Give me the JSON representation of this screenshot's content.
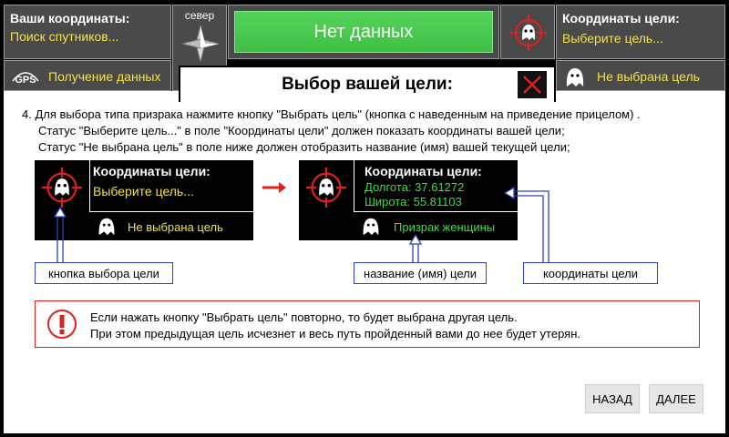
{
  "hud": {
    "coords_title": "Ваши координаты:",
    "coords_status": "Поиск спутников...",
    "gps_label": "GPS",
    "gps_status": "Получение данных",
    "compass_label": "север",
    "status_text": "Нет данных",
    "target_title": "Координаты цели:",
    "target_status": "Выберите цель...",
    "ghost_status": "Не выбрана цель"
  },
  "dialog": {
    "title": "Выбор вашей цели:",
    "instructions": [
      "4. Для выбора типа призрака нажмите кнопку \"Выбрать цель\"  (кнопка с наведенным на приведение прицелом) .",
      "Статус \"Выберите цель...\" в поле \"Координаты цели\"  должен показать координаты вашей цели;",
      "Статус \"Не выбрана цель\" в поле ниже должен отобразить название (имя) вашей текущей цели;"
    ],
    "example_before": {
      "title": "Координаты цели:",
      "status": "Выберите цель...",
      "ghost": "Не выбрана цель"
    },
    "example_after": {
      "title": "Координаты цели:",
      "longitude": "Долгота: 37.61272",
      "latitude": "Широта: 55.81103",
      "ghost": "Призрак женщины"
    },
    "callouts": {
      "select_button": "кнопка выбора цели",
      "target_name": "название (имя) цели",
      "target_coords": "координаты цели"
    },
    "warning": [
      "Если нажать кнопку \"Выбрать цель\" повторно, то будет выбрана другая цель.",
      "При этом предыдущая цель исчезнет и весь путь пройденный вами до нее будет утерян."
    ],
    "back_label": "НАЗАД",
    "next_label": "ДАЛЕЕ"
  },
  "colors": {
    "hud_bg": "#4a4a4a",
    "yellow_text": "#f2e14a",
    "green_text": "#39e03e",
    "status_green": "#4cc950",
    "accent_red": "#e02020",
    "callout_blue": "#3040c0"
  },
  "icons": {
    "compass": "compass-rose-icon",
    "target": "ghost-crosshair-icon",
    "ghost": "ghost-icon",
    "close": "close-x-icon",
    "warning": "exclamation-icon",
    "arrow": "red-arrow-icon"
  }
}
